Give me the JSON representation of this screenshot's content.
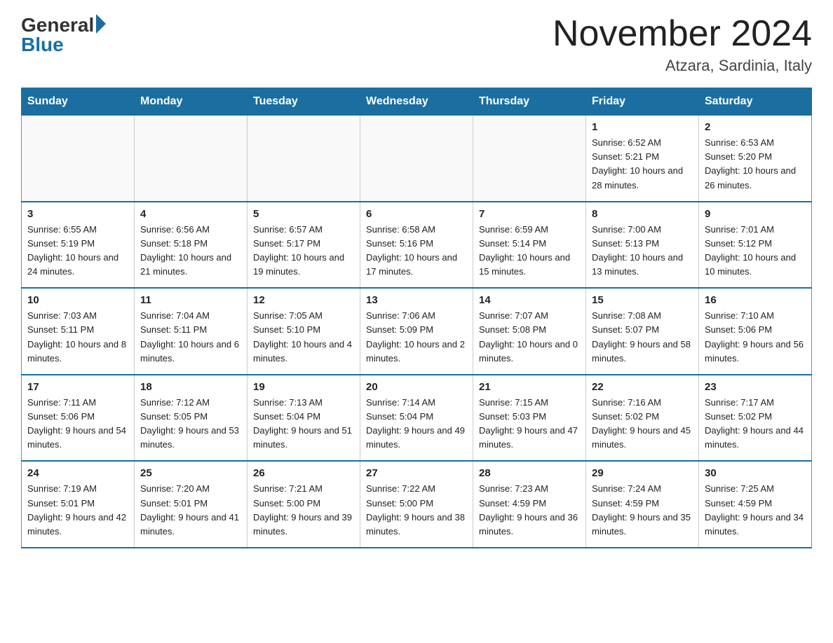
{
  "header": {
    "logo_general": "General",
    "logo_blue": "Blue",
    "month_title": "November 2024",
    "location": "Atzara, Sardinia, Italy"
  },
  "weekdays": [
    "Sunday",
    "Monday",
    "Tuesday",
    "Wednesday",
    "Thursday",
    "Friday",
    "Saturday"
  ],
  "weeks": [
    [
      {
        "day": "",
        "info": ""
      },
      {
        "day": "",
        "info": ""
      },
      {
        "day": "",
        "info": ""
      },
      {
        "day": "",
        "info": ""
      },
      {
        "day": "",
        "info": ""
      },
      {
        "day": "1",
        "info": "Sunrise: 6:52 AM\nSunset: 5:21 PM\nDaylight: 10 hours and 28 minutes."
      },
      {
        "day": "2",
        "info": "Sunrise: 6:53 AM\nSunset: 5:20 PM\nDaylight: 10 hours and 26 minutes."
      }
    ],
    [
      {
        "day": "3",
        "info": "Sunrise: 6:55 AM\nSunset: 5:19 PM\nDaylight: 10 hours and 24 minutes."
      },
      {
        "day": "4",
        "info": "Sunrise: 6:56 AM\nSunset: 5:18 PM\nDaylight: 10 hours and 21 minutes."
      },
      {
        "day": "5",
        "info": "Sunrise: 6:57 AM\nSunset: 5:17 PM\nDaylight: 10 hours and 19 minutes."
      },
      {
        "day": "6",
        "info": "Sunrise: 6:58 AM\nSunset: 5:16 PM\nDaylight: 10 hours and 17 minutes."
      },
      {
        "day": "7",
        "info": "Sunrise: 6:59 AM\nSunset: 5:14 PM\nDaylight: 10 hours and 15 minutes."
      },
      {
        "day": "8",
        "info": "Sunrise: 7:00 AM\nSunset: 5:13 PM\nDaylight: 10 hours and 13 minutes."
      },
      {
        "day": "9",
        "info": "Sunrise: 7:01 AM\nSunset: 5:12 PM\nDaylight: 10 hours and 10 minutes."
      }
    ],
    [
      {
        "day": "10",
        "info": "Sunrise: 7:03 AM\nSunset: 5:11 PM\nDaylight: 10 hours and 8 minutes."
      },
      {
        "day": "11",
        "info": "Sunrise: 7:04 AM\nSunset: 5:11 PM\nDaylight: 10 hours and 6 minutes."
      },
      {
        "day": "12",
        "info": "Sunrise: 7:05 AM\nSunset: 5:10 PM\nDaylight: 10 hours and 4 minutes."
      },
      {
        "day": "13",
        "info": "Sunrise: 7:06 AM\nSunset: 5:09 PM\nDaylight: 10 hours and 2 minutes."
      },
      {
        "day": "14",
        "info": "Sunrise: 7:07 AM\nSunset: 5:08 PM\nDaylight: 10 hours and 0 minutes."
      },
      {
        "day": "15",
        "info": "Sunrise: 7:08 AM\nSunset: 5:07 PM\nDaylight: 9 hours and 58 minutes."
      },
      {
        "day": "16",
        "info": "Sunrise: 7:10 AM\nSunset: 5:06 PM\nDaylight: 9 hours and 56 minutes."
      }
    ],
    [
      {
        "day": "17",
        "info": "Sunrise: 7:11 AM\nSunset: 5:06 PM\nDaylight: 9 hours and 54 minutes."
      },
      {
        "day": "18",
        "info": "Sunrise: 7:12 AM\nSunset: 5:05 PM\nDaylight: 9 hours and 53 minutes."
      },
      {
        "day": "19",
        "info": "Sunrise: 7:13 AM\nSunset: 5:04 PM\nDaylight: 9 hours and 51 minutes."
      },
      {
        "day": "20",
        "info": "Sunrise: 7:14 AM\nSunset: 5:04 PM\nDaylight: 9 hours and 49 minutes."
      },
      {
        "day": "21",
        "info": "Sunrise: 7:15 AM\nSunset: 5:03 PM\nDaylight: 9 hours and 47 minutes."
      },
      {
        "day": "22",
        "info": "Sunrise: 7:16 AM\nSunset: 5:02 PM\nDaylight: 9 hours and 45 minutes."
      },
      {
        "day": "23",
        "info": "Sunrise: 7:17 AM\nSunset: 5:02 PM\nDaylight: 9 hours and 44 minutes."
      }
    ],
    [
      {
        "day": "24",
        "info": "Sunrise: 7:19 AM\nSunset: 5:01 PM\nDaylight: 9 hours and 42 minutes."
      },
      {
        "day": "25",
        "info": "Sunrise: 7:20 AM\nSunset: 5:01 PM\nDaylight: 9 hours and 41 minutes."
      },
      {
        "day": "26",
        "info": "Sunrise: 7:21 AM\nSunset: 5:00 PM\nDaylight: 9 hours and 39 minutes."
      },
      {
        "day": "27",
        "info": "Sunrise: 7:22 AM\nSunset: 5:00 PM\nDaylight: 9 hours and 38 minutes."
      },
      {
        "day": "28",
        "info": "Sunrise: 7:23 AM\nSunset: 4:59 PM\nDaylight: 9 hours and 36 minutes."
      },
      {
        "day": "29",
        "info": "Sunrise: 7:24 AM\nSunset: 4:59 PM\nDaylight: 9 hours and 35 minutes."
      },
      {
        "day": "30",
        "info": "Sunrise: 7:25 AM\nSunset: 4:59 PM\nDaylight: 9 hours and 34 minutes."
      }
    ]
  ]
}
